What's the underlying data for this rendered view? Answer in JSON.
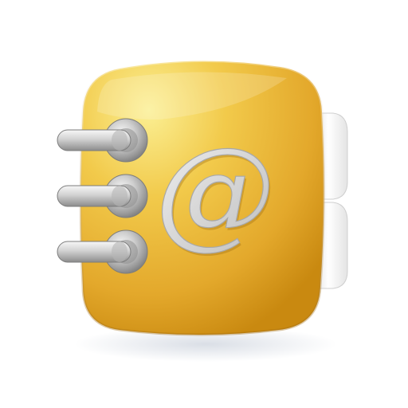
{
  "app_icon": {
    "name": "address-book-email-icon",
    "glyph": "@",
    "colors": {
      "background": "#ffffff",
      "cover_light": "#f8e47a",
      "cover_mid": "#f0bf3e",
      "cover_dark": "#d89a1f",
      "cover_edge": "#b97b10",
      "metal_light": "#f4f4f4",
      "metal_mid": "#c8c8c8",
      "metal_dark": "#8f8f8f",
      "tab": "#f2f2f2",
      "emboss": "#d6d6d6"
    },
    "ring_count": 3,
    "tab_count": 2
  }
}
